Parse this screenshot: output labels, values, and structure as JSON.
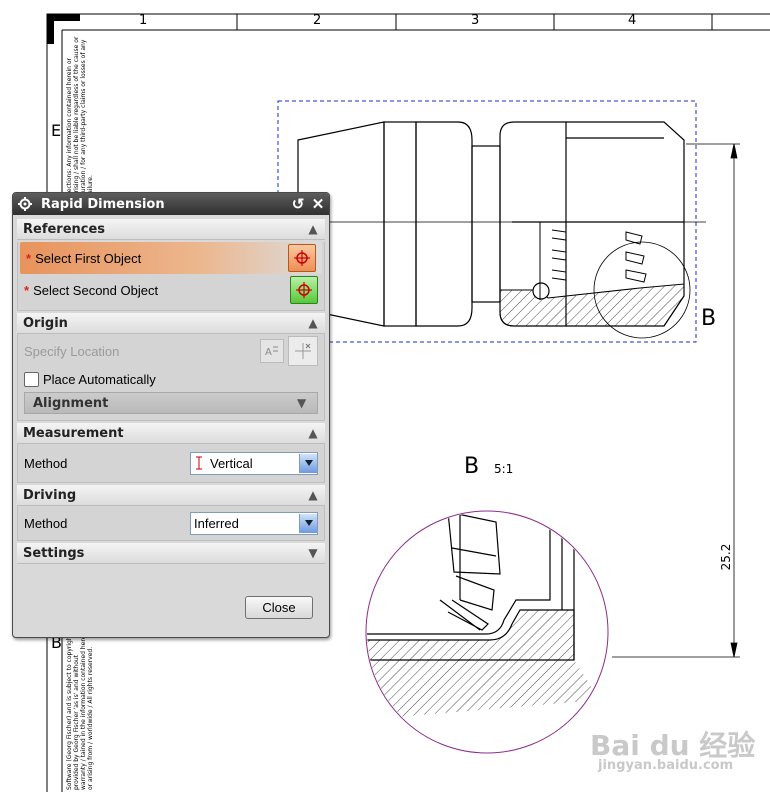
{
  "drawing": {
    "zone_labels": [
      "1",
      "2",
      "3",
      "4"
    ],
    "row_letter_top": "E",
    "row_letter_bottom": "B",
    "section_marker": "B",
    "detail_view_label": "B",
    "detail_view_scale": "5:1",
    "dimension_value": "25.2",
    "fine_print_top": "Sections: Any information contained herein or arising / shall not be liable regardless of the cause or duration / for any third-party claims or losses of any failure.",
    "fine_print_bottom": "Software (Georg Fischer) and is subject to copyright / provided by Georg Fischer 'as is' and without warranty / tained in the information contained herein or arising from / worldwide / All rights reserved."
  },
  "dialog": {
    "title": "Rapid Dimension",
    "references": {
      "header": "References",
      "first_object": "Select First Object",
      "second_object": "Select Second Object",
      "required_marker": "*"
    },
    "origin": {
      "header": "Origin",
      "specify_location": "Specify Location",
      "place_automatically": "Place Automatically",
      "alignment": "Alignment"
    },
    "measurement": {
      "header": "Measurement",
      "method_label": "Method",
      "method_value": "Vertical"
    },
    "driving": {
      "header": "Driving",
      "method_label": "Method",
      "method_value": "Inferred"
    },
    "settings": {
      "header": "Settings"
    },
    "close_label": "Close"
  },
  "watermark": {
    "brand": "Bai du 经验",
    "url": "jingyan.baidu.com"
  },
  "icons": {
    "dialog_gear": "gear-icon",
    "reset": "reset-icon",
    "close": "close-icon",
    "crosshair": "crosshair-icon",
    "collapse": "chevron-up-icon",
    "expand": "chevron-down-icon",
    "dropdown": "dropdown-arrow-icon",
    "vertical_dimension": "vertical-dimension-icon",
    "text_annotation": "text-annotation-icon",
    "point_location": "point-location-icon"
  },
  "colors": {
    "dialog_bg": "#d9d9d9",
    "titlebar": "#2f2f2f",
    "selected_row": "#e8935c",
    "crosshair_red": "#cc0000",
    "dashed_blue": "#1b2bd1",
    "detail_circle": "#8b2c8b",
    "green_button": "#56c83a"
  }
}
